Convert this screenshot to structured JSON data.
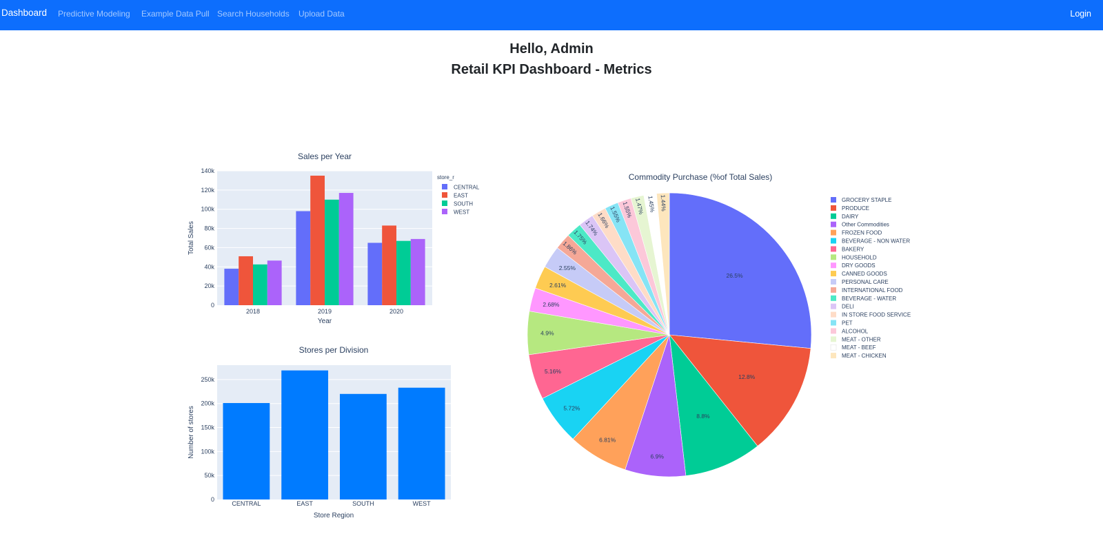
{
  "nav": {
    "brand": "Dashboard",
    "links": [
      "Predictive Modeling",
      "Example Data Pull",
      "Search Households",
      "Upload Data"
    ],
    "login": "Login"
  },
  "header": {
    "greeting": "Hello, Admin",
    "title": "Retail KPI Dashboard - Metrics"
  },
  "colors": {
    "navbar": "#0d6efd",
    "plot_bg": "#e5ecf6",
    "stores_bar": "#007bff"
  },
  "chart_data": [
    {
      "type": "bar",
      "title": "Sales per Year",
      "xlabel": "Year",
      "ylabel": "Total Sales",
      "categories": [
        "2018",
        "2019",
        "2020"
      ],
      "series": [
        {
          "name": "CENTRAL",
          "color": "#636efa",
          "values": [
            38000,
            98000,
            65000
          ]
        },
        {
          "name": "EAST",
          "color": "#ef553b",
          "values": [
            51000,
            135000,
            83000
          ]
        },
        {
          "name": "SOUTH",
          "color": "#00cc96",
          "values": [
            42500,
            110000,
            67000
          ]
        },
        {
          "name": "WEST",
          "color": "#ab63fa",
          "values": [
            46500,
            117000,
            69000
          ]
        }
      ],
      "ylim": [
        0,
        140000
      ],
      "yticks": [
        "0",
        "20k",
        "40k",
        "60k",
        "80k",
        "100k",
        "120k",
        "140k"
      ],
      "legend_title": "store_r",
      "legend_position": "top-right",
      "grid": true
    },
    {
      "type": "bar",
      "title": "Stores per Division",
      "xlabel": "Store Region",
      "ylabel": "Number of stores",
      "categories": [
        "CENTRAL",
        "EAST",
        "SOUTH",
        "WEST"
      ],
      "values": [
        201000,
        269000,
        220000,
        233000
      ],
      "ylim": [
        0,
        280000
      ],
      "yticks": [
        "0",
        "50k",
        "100k",
        "150k",
        "200k",
        "250k"
      ],
      "grid": true
    },
    {
      "type": "pie",
      "title": "Commodity Purchase (%of Total Sales)",
      "legend_position": "right",
      "slices": [
        {
          "label": "GROCERY STAPLE",
          "value": 26.5,
          "text": "26.5%",
          "color": "#636efa"
        },
        {
          "label": "PRODUCE",
          "value": 12.8,
          "text": "12.8%",
          "color": "#ef553b"
        },
        {
          "label": "DAIRY",
          "value": 8.8,
          "text": "8.8%",
          "color": "#00cc96"
        },
        {
          "label": "Other Commodities",
          "value": 6.9,
          "text": "6.9%",
          "color": "#ab63fa"
        },
        {
          "label": "FROZEN FOOD",
          "value": 6.81,
          "text": "6.81%",
          "color": "#ffa15a"
        },
        {
          "label": "BEVERAGE - NON WATER",
          "value": 5.72,
          "text": "5.72%",
          "color": "#19d3f3"
        },
        {
          "label": "BAKERY",
          "value": 5.16,
          "text": "5.16%",
          "color": "#ff6692"
        },
        {
          "label": "HOUSEHOLD",
          "value": 4.9,
          "text": "4.9%",
          "color": "#b6e880"
        },
        {
          "label": "DRY GOODS",
          "value": 2.68,
          "text": "2.68%",
          "color": "#ff97ff"
        },
        {
          "label": "CANNED GOODS",
          "value": 2.61,
          "text": "2.61%",
          "color": "#fecb52"
        },
        {
          "label": "PERSONAL CARE",
          "value": 2.55,
          "text": "2.55%",
          "color": "#c6cbf7"
        },
        {
          "label": "INTERNATIONAL FOOD",
          "value": 1.86,
          "text": "1.86%",
          "color": "#f5a897"
        },
        {
          "label": "BEVERAGE - WATER",
          "value": 1.75,
          "text": "1.75%",
          "color": "#4ce9c6"
        },
        {
          "label": "DELI",
          "value": 1.74,
          "text": "1.74%",
          "color": "#dbc5f6"
        },
        {
          "label": "IN STORE FOOD SERVICE",
          "value": 1.66,
          "text": "1.66%",
          "color": "#fedcc7"
        },
        {
          "label": "PET",
          "value": 1.55,
          "text": "1.55%",
          "color": "#86e4f5"
        },
        {
          "label": "ALCOHOL",
          "value": 1.55,
          "text": "1.55%",
          "color": "#fcc8d9"
        },
        {
          "label": "MEAT - OTHER",
          "value": 1.47,
          "text": "1.47%",
          "color": "#e6f5d2"
        },
        {
          "label": "MEAT - BEEF",
          "value": 1.45,
          "text": "1.45%",
          "color": "#ffffff"
        },
        {
          "label": "MEAT - CHICKEN",
          "value": 1.44,
          "text": "1.44%",
          "color": "#fde6bd"
        }
      ]
    }
  ]
}
